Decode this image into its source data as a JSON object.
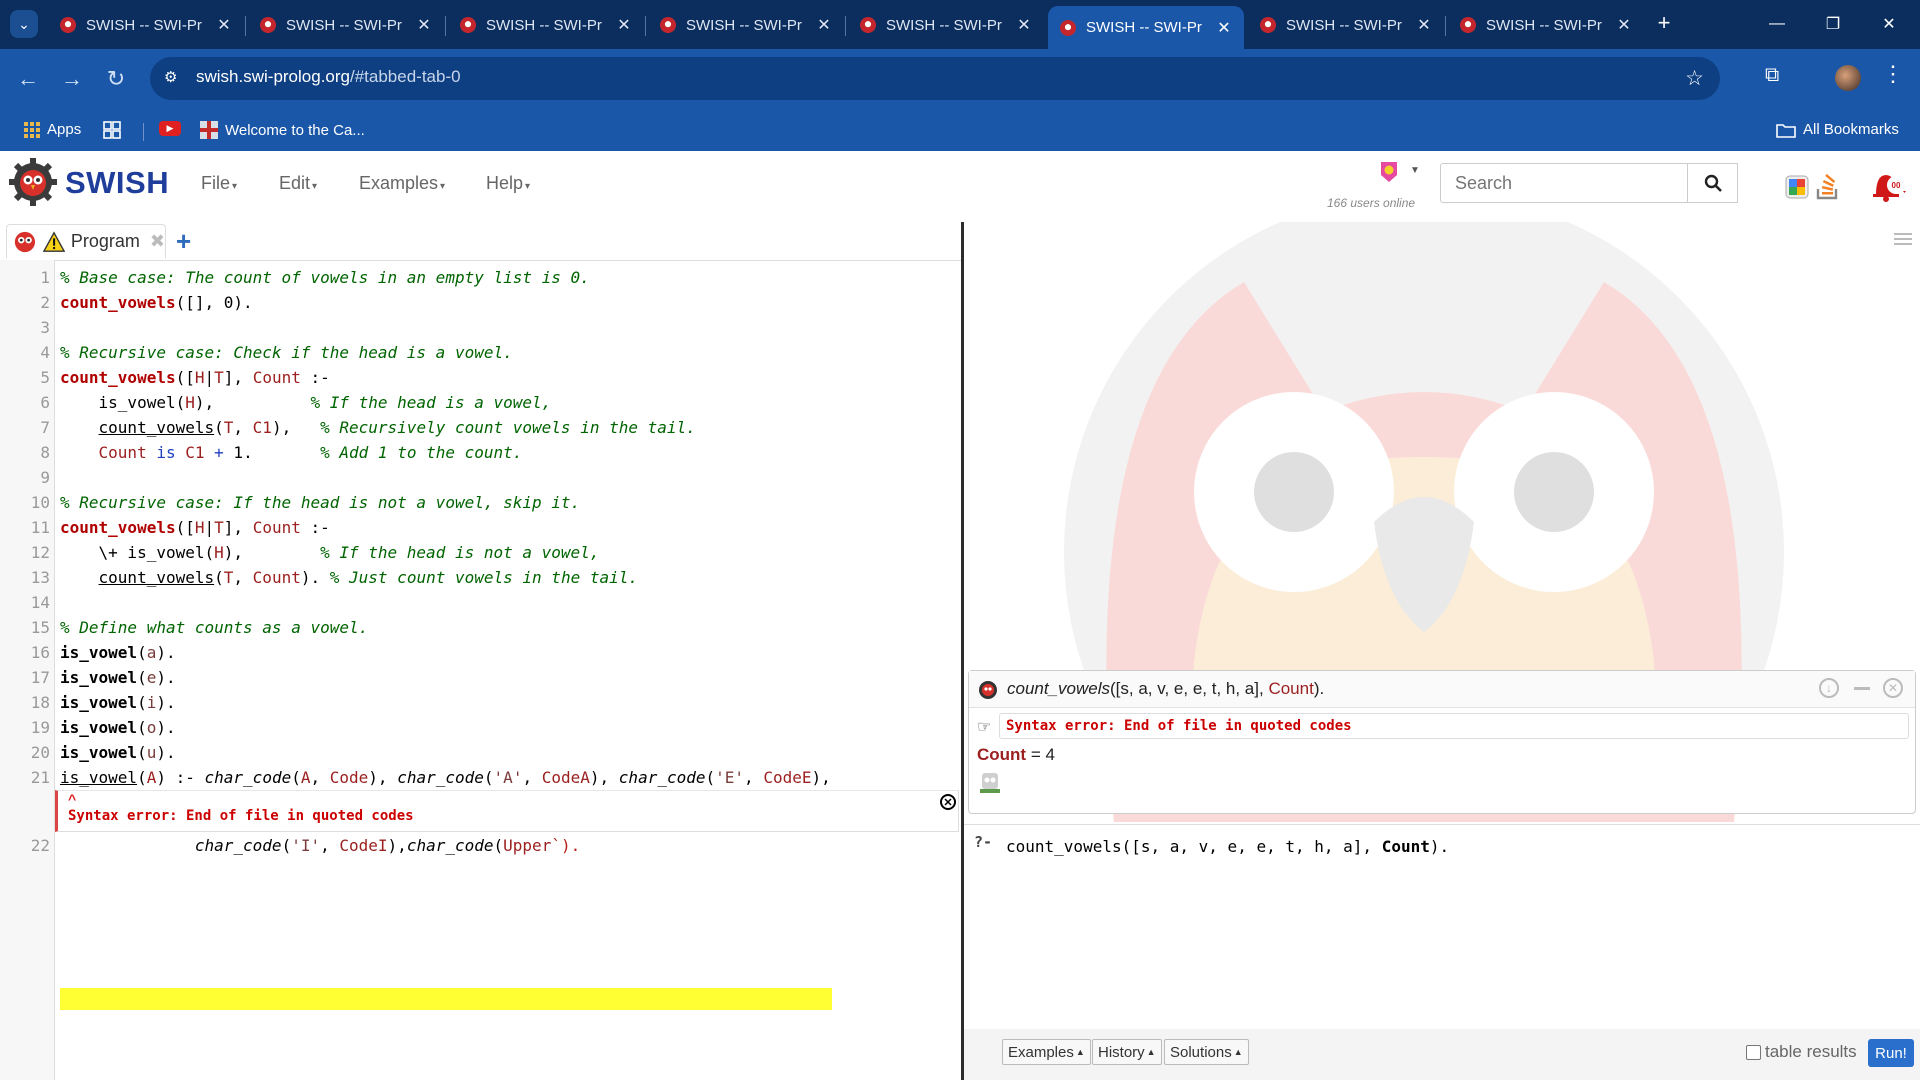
{
  "browser": {
    "tabs": [
      {
        "title": "SWISH -- SWI-Pr",
        "active": false
      },
      {
        "title": "SWISH -- SWI-Pr",
        "active": false
      },
      {
        "title": "SWISH -- SWI-Pr",
        "active": false
      },
      {
        "title": "SWISH -- SWI-Pr",
        "active": false
      },
      {
        "title": "SWISH -- SWI-Pr",
        "active": false
      },
      {
        "title": "SWISH -- SWI-Pr",
        "active": true
      },
      {
        "title": "SWISH -- SWI-Pr",
        "active": false
      },
      {
        "title": "SWISH -- SWI-Pr",
        "active": false
      }
    ],
    "url_host": "swish.swi-prolog.org",
    "url_path": "/#tabbed-tab-0",
    "bookmarks": {
      "apps_label": "Apps",
      "welcome_label": "Welcome to the Ca...",
      "all_bookmarks_label": "All Bookmarks"
    }
  },
  "swish": {
    "brand": "SWISH",
    "menus": [
      "File",
      "Edit",
      "Examples",
      "Help"
    ],
    "users_online": "166 users online",
    "search_placeholder": "Search"
  },
  "editor": {
    "tab_label": "Program",
    "line_numbers": [
      "1",
      "2",
      "3",
      "4",
      "5",
      "6",
      "7",
      "8",
      "9",
      "10",
      "11",
      "12",
      "13",
      "14",
      "15",
      "16",
      "17",
      "18",
      "19",
      "20",
      "21",
      "22"
    ],
    "error_message": "Syntax error: End of file in quoted codes"
  },
  "answer": {
    "query_pred": "count_vowels",
    "query_args": "([s, a, v, e, e, t, h, a], ",
    "query_var": "Count",
    "query_end": ").",
    "error_message": "Syntax error: End of file in quoted codes",
    "result_var": "Count",
    "result_value": " = 4"
  },
  "query": {
    "prompt": "?-",
    "text_pre": "count_vowels([s, a, v, e, e, t, h, a], ",
    "text_var": "Count",
    "text_post": ").",
    "buttons": {
      "examples": "Examples",
      "history": "History",
      "solutions": "Solutions"
    },
    "table_results_label": "table results",
    "run_label": "Run!"
  },
  "colors": {
    "tabbar_bg": "#0b2e5e",
    "chrome_blue": "#1b57a8",
    "swish_brand": "#1f3e9b",
    "comment_green": "#006400",
    "error_red": "#c00000",
    "highlight_yellow": "#ffff33",
    "run_button": "#2a6fcc"
  }
}
